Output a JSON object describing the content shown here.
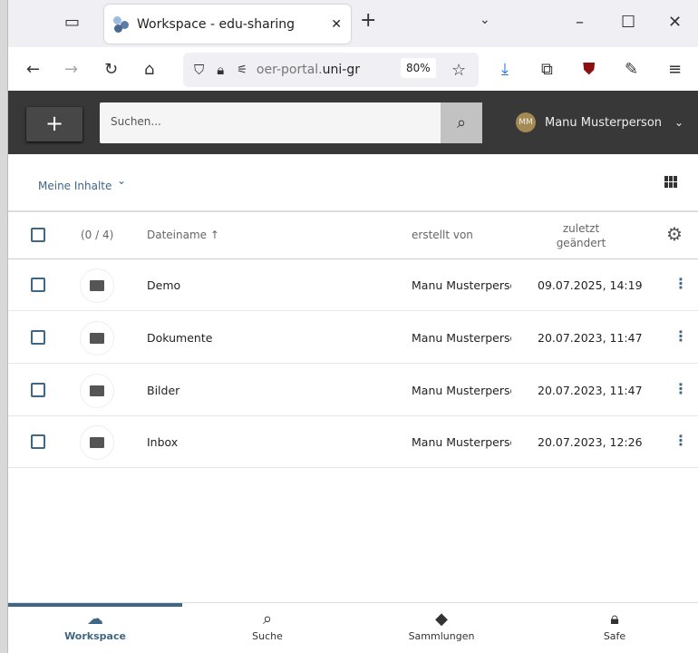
{
  "browser": {
    "tab_title": "Workspace - edu-sharing",
    "url_gray": "oer-portal.",
    "url_bold": "uni-gr",
    "zoom": "80%"
  },
  "header": {
    "add_label": "+",
    "search_placeholder": "Suchen...",
    "user_initials": "MM",
    "user_name": "Manu Musterperson"
  },
  "toolbar": {
    "scope_label": "Meine Inhalte"
  },
  "table": {
    "selection_count": "(0 / 4)",
    "col_name": "Dateiname",
    "col_creator": "erstellt von",
    "col_modified_1": "zuletzt",
    "col_modified_2": "geändert",
    "rows": [
      {
        "name": "Demo",
        "creator": "Manu Musterperso",
        "modified": "09.07.2025, 14:19"
      },
      {
        "name": "Dokumente",
        "creator": "Manu Musterperso",
        "modified": "20.07.2023, 11:47"
      },
      {
        "name": "Bilder",
        "creator": "Manu Musterperso",
        "modified": "20.07.2023, 11:47"
      },
      {
        "name": "Inbox",
        "creator": "Manu Musterperso",
        "modified": "20.07.2023, 12:26"
      }
    ]
  },
  "bottom_nav": [
    {
      "label": "Workspace"
    },
    {
      "label": "Suche"
    },
    {
      "label": "Sammlungen"
    },
    {
      "label": "Safe"
    }
  ]
}
